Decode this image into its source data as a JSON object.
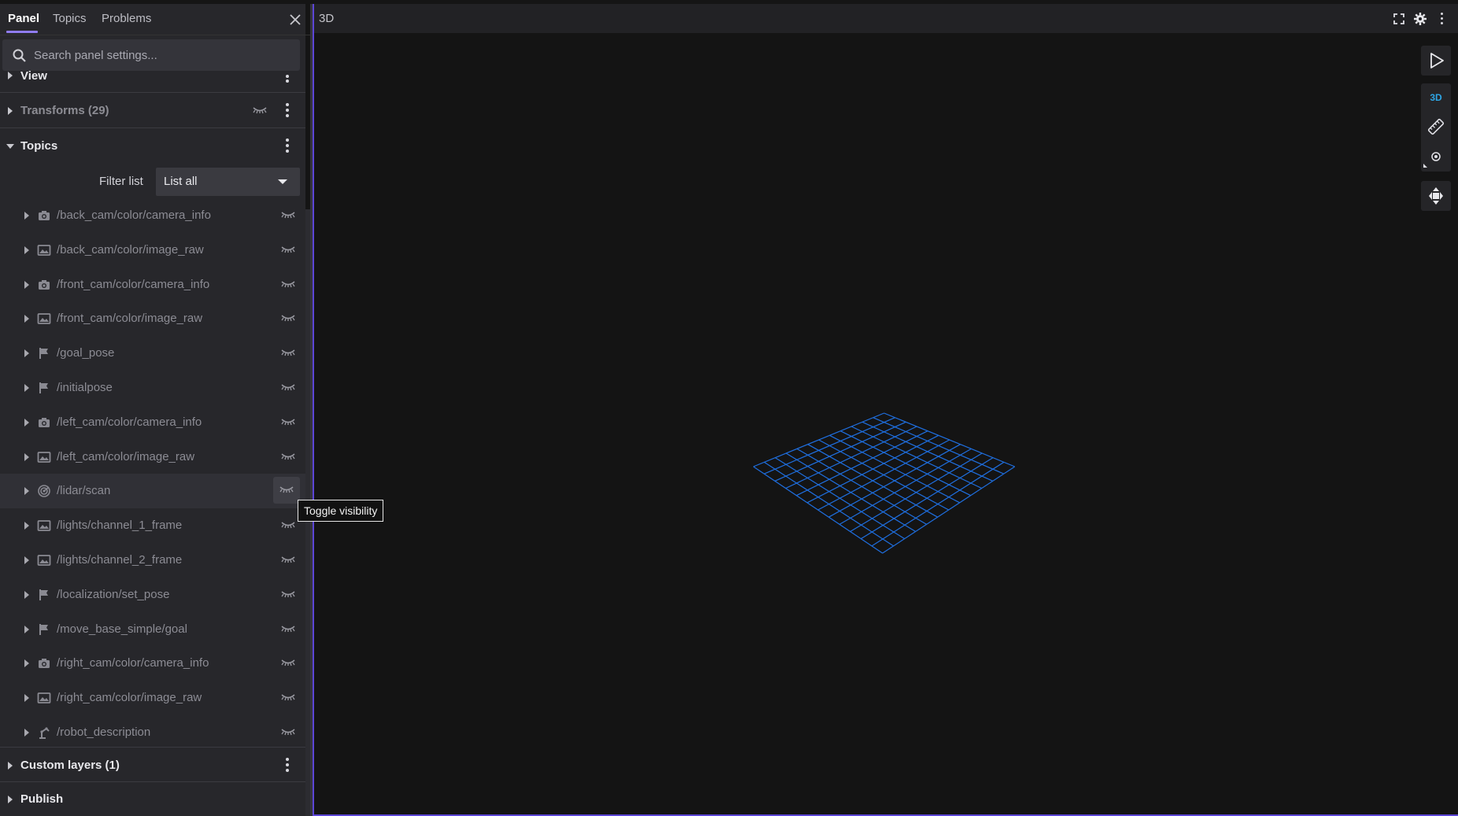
{
  "sidebar": {
    "tabs": [
      {
        "label": "Panel",
        "active": true
      },
      {
        "label": "Topics",
        "active": false
      },
      {
        "label": "Problems",
        "active": false
      }
    ],
    "search_placeholder": "Search panel settings...",
    "sections": {
      "view": {
        "label": "View"
      },
      "transforms": {
        "label": "Transforms (29)"
      },
      "topics": {
        "label": "Topics",
        "filter_label": "Filter list",
        "filter_value": "List all"
      },
      "custom_layers": {
        "label": "Custom layers (1)"
      },
      "publish": {
        "label": "Publish"
      }
    },
    "topics": [
      {
        "name": "/back_cam/color/camera_info",
        "icon": "camera-icon"
      },
      {
        "name": "/back_cam/color/image_raw",
        "icon": "image-icon"
      },
      {
        "name": "/front_cam/color/camera_info",
        "icon": "camera-icon"
      },
      {
        "name": "/front_cam/color/image_raw",
        "icon": "image-icon"
      },
      {
        "name": "/goal_pose",
        "icon": "flag-icon"
      },
      {
        "name": "/initialpose",
        "icon": "flag-icon"
      },
      {
        "name": "/left_cam/color/camera_info",
        "icon": "camera-icon"
      },
      {
        "name": "/left_cam/color/image_raw",
        "icon": "image-icon"
      },
      {
        "name": "/lidar/scan",
        "icon": "radar-icon"
      },
      {
        "name": "/lights/channel_1_frame",
        "icon": "image-icon"
      },
      {
        "name": "/lights/channel_2_frame",
        "icon": "image-icon"
      },
      {
        "name": "/localization/set_pose",
        "icon": "flag-icon"
      },
      {
        "name": "/move_base_simple/goal",
        "icon": "flag-icon"
      },
      {
        "name": "/right_cam/color/camera_info",
        "icon": "camera-icon"
      },
      {
        "name": "/right_cam/color/image_raw",
        "icon": "image-icon"
      },
      {
        "name": "/robot_description",
        "icon": "robot-arm-icon"
      }
    ]
  },
  "tooltip": {
    "text": "Toggle visibility"
  },
  "main": {
    "title": "3D",
    "toolbar": {
      "mode_3d_label": "3D"
    }
  },
  "colors": {
    "accent": "#8f7cf0",
    "grid": "#1f6fe0",
    "mode_3d": "#2ea6e6",
    "focus_border": "#5c46d6"
  }
}
